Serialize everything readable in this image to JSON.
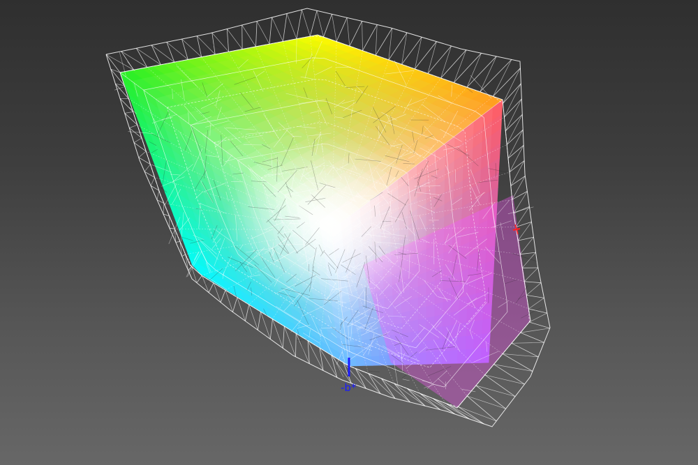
{
  "gamut_view": {
    "axes": [
      {
        "name": "-b-axis",
        "label": "-b*",
        "color": "#1a1aff"
      },
      {
        "name": "a-axis-marker",
        "label": "",
        "color": "#ff2020"
      }
    ],
    "colors": {
      "green": "#22ee22",
      "yellow": "#ffff00",
      "orange": "#ff9a1a",
      "red": "#ff5a60",
      "magenta": "#ff55ff",
      "violet": "#9d66ff",
      "blue": "#6ab8ff",
      "cyan": "#00ffff",
      "white": "#ffffff",
      "wireframe": "#ffffff"
    }
  }
}
